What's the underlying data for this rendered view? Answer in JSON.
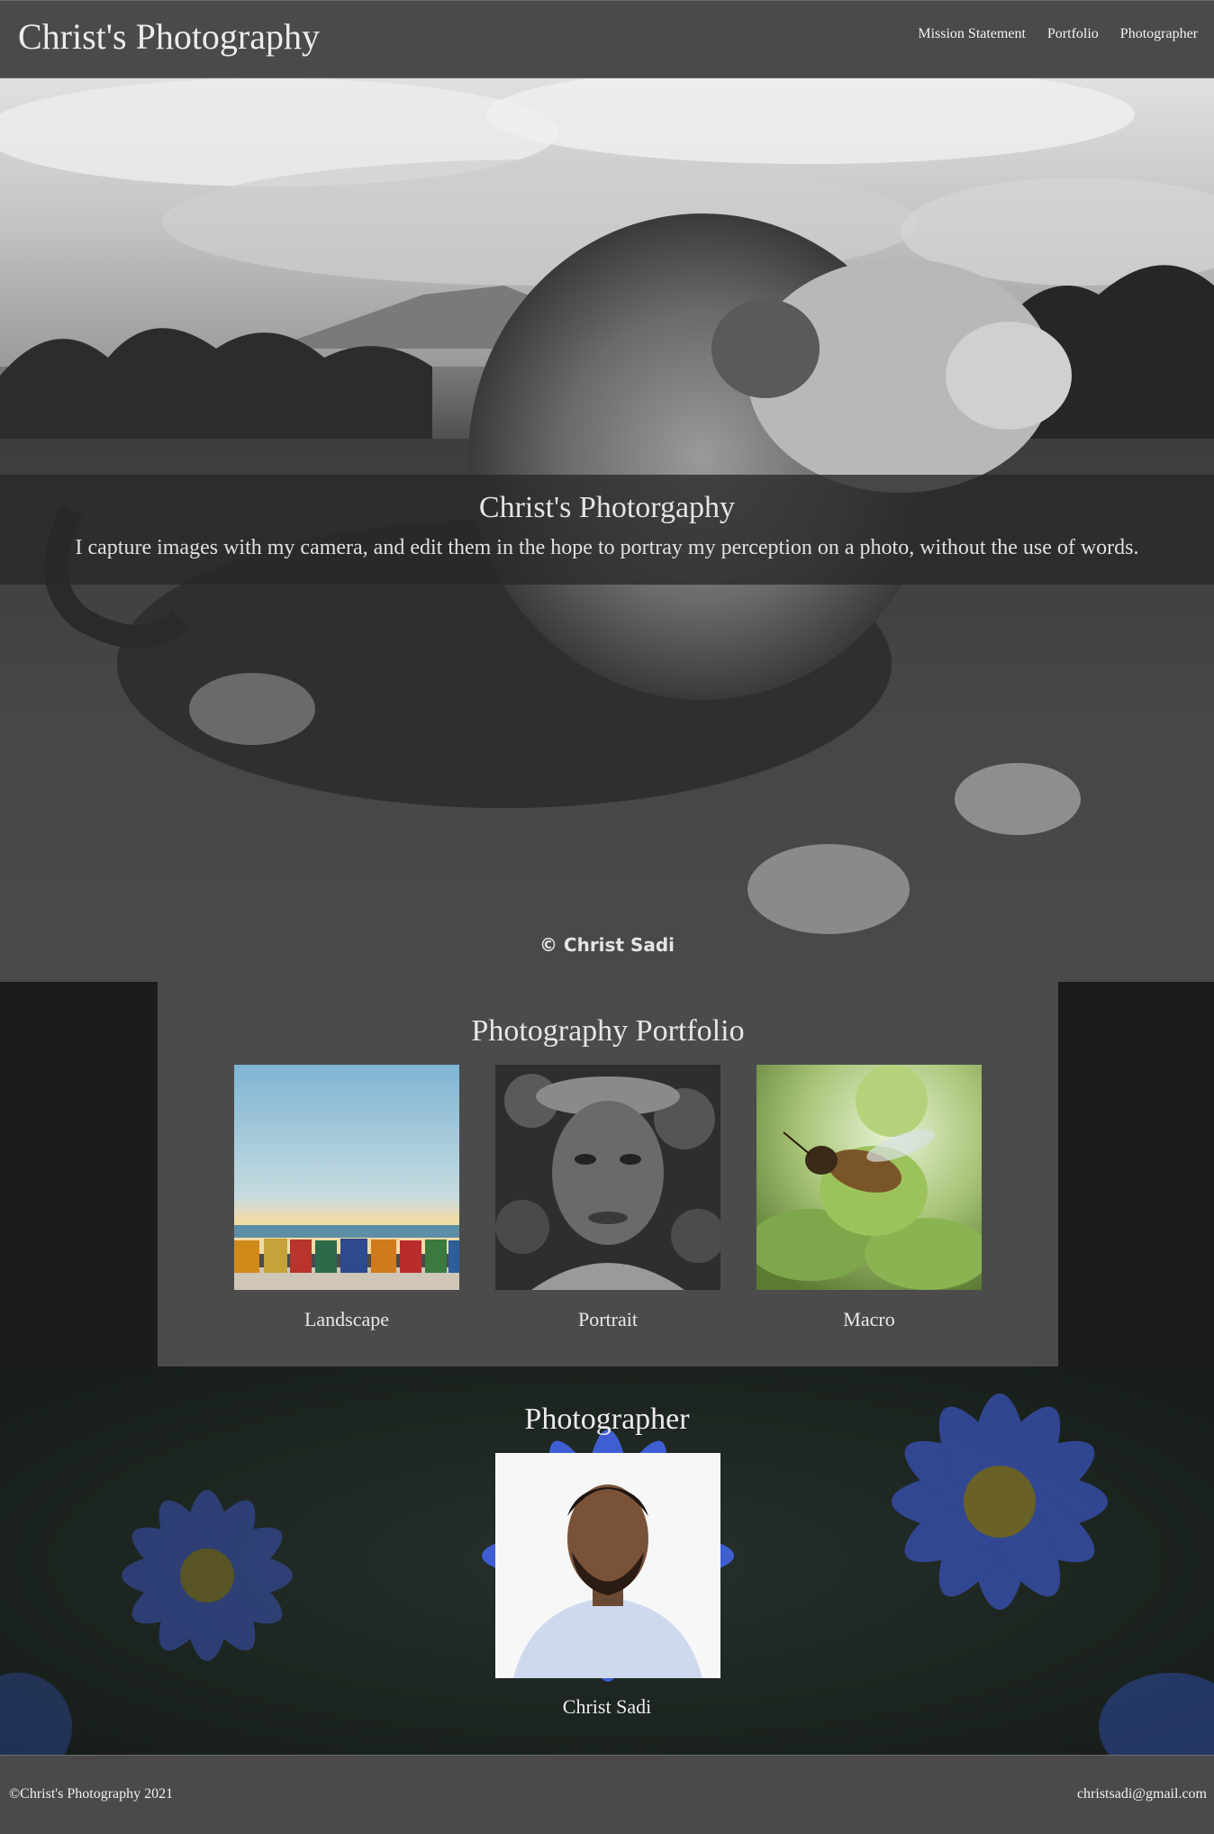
{
  "header": {
    "brand": "Christ's Photography",
    "nav": [
      "Mission Statement",
      "Portfolio",
      "Photographer"
    ]
  },
  "hero": {
    "title": "Christ's Photorgaphy",
    "text": "I capture images with my camera, and edit them in the hope to portray my perception on a photo, without the use of words.",
    "watermark": "© Christ Sadi"
  },
  "portfolio": {
    "title": "Photography Portfolio",
    "items": [
      {
        "label": "Landscape"
      },
      {
        "label": "Portrait"
      },
      {
        "label": "Macro"
      }
    ]
  },
  "photographer": {
    "title": "Photographer",
    "name": "Christ Sadi"
  },
  "footer": {
    "copyright": "©Christ's Photography 2021",
    "email": "christsadi@gmail.com"
  },
  "colors": {
    "header_bg": "#4a4a4a",
    "portfolio_bg": "#4b4b4b",
    "page_bg": "#1c1c1c",
    "flower_blue": "#3a54b8"
  }
}
